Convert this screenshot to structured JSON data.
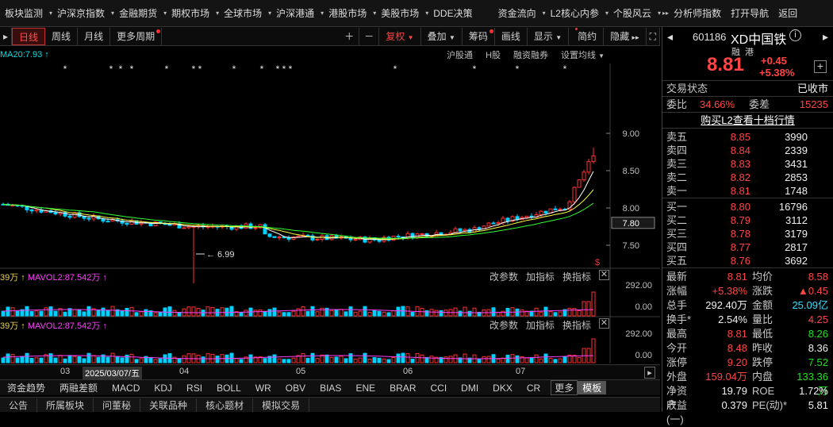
{
  "menu": [
    "板块监测",
    "沪深京指数",
    "金融期货",
    "期权市场",
    "全球市场",
    "沪深港通",
    "港股市场",
    "美股市场",
    "DDE决策",
    "资金流向",
    "L2核心内参",
    "个股风云",
    "分析师指数",
    "打开导航",
    "返回"
  ],
  "toolbar": {
    "left": [
      "日线",
      "周线",
      "月线",
      "更多周期"
    ],
    "right": [
      "复权",
      "叠加",
      "筹码",
      "画线",
      "显示",
      "简约",
      "隐藏"
    ]
  },
  "ma_label": "MA20:7.93 ↑",
  "chart_tabs": [
    "沪股通",
    "H股",
    "融资融券",
    "设置均线"
  ],
  "chart_data": {
    "type": "candlestick",
    "ticks": [
      "9.00",
      "8.50",
      "8.00",
      "7.50"
    ],
    "last_price_tag": "7.80",
    "low_note": "6.99",
    "vol_ticks": [
      "292.00",
      "0.00"
    ],
    "month_labels": [
      "03",
      "04",
      "05",
      "06",
      "07"
    ],
    "date_sel": "2025/03/07/五"
  },
  "vol1": {
    "left": "39万",
    "right": "MAVOL2:87.542万"
  },
  "vol2": {
    "left": "39万",
    "right": "MAVOL2:87.542万"
  },
  "vctl": [
    "改参数",
    "加指标",
    "换指标"
  ],
  "indicators": [
    "资金趋势",
    "两融差额",
    "MACD",
    "KDJ",
    "RSI",
    "BOLL",
    "WR",
    "OBV",
    "BIAS",
    "ENE",
    "BRAR",
    "CCI",
    "DMI",
    "DKX",
    "CR"
  ],
  "ind_more": "更多",
  "ind_sel": "模板",
  "bottom": [
    "公告",
    "所属板块",
    "问董秘",
    "关联品种",
    "核心题材",
    "模拟交易"
  ],
  "stock": {
    "code": "601186",
    "name": "XD中国铁",
    "badge1": "融",
    "badge2": "港",
    "price": "8.81",
    "chg": "+0.45",
    "pct": "+5.38%"
  },
  "status": {
    "label": "交易状态",
    "value": "已收市"
  },
  "weibi": {
    "l1": "委比",
    "v1": "34.66%",
    "l2": "委差",
    "v2": "15235"
  },
  "l2_link": "购买L2查看十档行情",
  "sells": [
    [
      "卖五",
      "8.85",
      "3990"
    ],
    [
      "卖四",
      "8.84",
      "2339"
    ],
    [
      "卖三",
      "8.83",
      "3431"
    ],
    [
      "卖二",
      "8.82",
      "2853"
    ],
    [
      "卖一",
      "8.81",
      "1748"
    ]
  ],
  "buys": [
    [
      "买一",
      "8.80",
      "16796"
    ],
    [
      "买二",
      "8.79",
      "3112"
    ],
    [
      "买三",
      "8.78",
      "3179"
    ],
    [
      "买四",
      "8.77",
      "2817"
    ],
    [
      "买五",
      "8.76",
      "3692"
    ]
  ],
  "stats": [
    [
      "最新",
      "8.81",
      "均价",
      "8.58"
    ],
    [
      "涨幅",
      "+5.38%",
      "涨跌",
      "▲0.45"
    ],
    [
      "总手",
      "292.40万",
      "金额",
      "25.09亿"
    ],
    [
      "换手*",
      "2.54%",
      "量比",
      "4.25"
    ],
    [
      "最高",
      "8.81",
      "最低",
      "8.26"
    ],
    [
      "今开",
      "8.48",
      "昨收",
      "8.36"
    ],
    [
      "涨停",
      "9.20",
      "跌停",
      "7.52"
    ],
    [
      "外盘",
      "159.04万",
      "内盘",
      "133.36万"
    ],
    [
      "净资产",
      "19.79",
      "ROE",
      "1.72%"
    ],
    [
      "收益(一)",
      "0.379",
      "PE(动)*",
      "5.81"
    ]
  ]
}
